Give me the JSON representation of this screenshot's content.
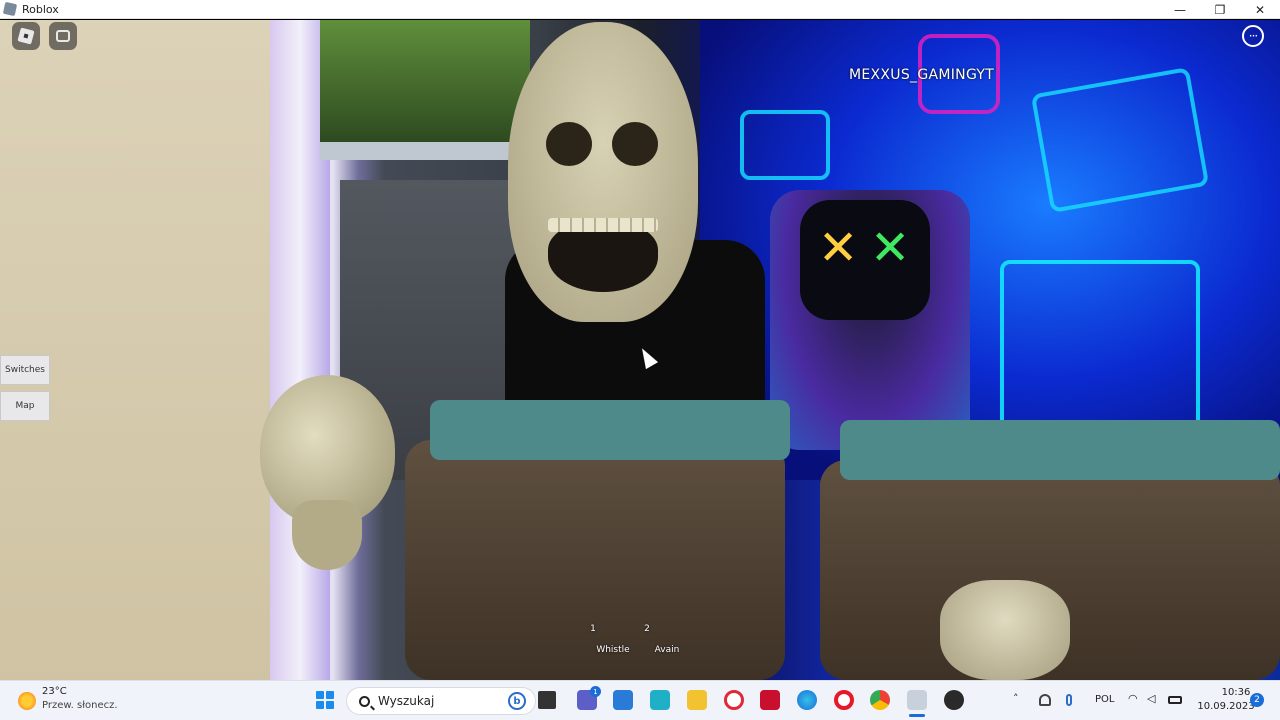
{
  "window": {
    "title": "Roblox",
    "controls": {
      "minimize": "—",
      "maximize": "❐",
      "close": "✕"
    }
  },
  "hud": {
    "menu_icon": "roblox-logo-icon",
    "chat_icon": "chat-icon",
    "more_label": "···",
    "player_name": "MEXXUS_GAMINGYT",
    "side_buttons": [
      {
        "label": "Switches"
      },
      {
        "label": "Map"
      }
    ],
    "hotbar": [
      {
        "slot": "1",
        "label": "Whistle"
      },
      {
        "slot": "2",
        "label": "Avain"
      }
    ]
  },
  "taskbar": {
    "weather": {
      "temp": "23°C",
      "desc": "Przew. słonecz."
    },
    "search_placeholder": "Wyszukaj",
    "chat_badge": "1",
    "apps": [
      "file-explorer-icon",
      "teams-chat-icon",
      "store-icon",
      "l-app-icon",
      "folder-icon",
      "opera-gx-icon",
      "mcafee-icon",
      "edge-icon",
      "opera-icon",
      "chrome-icon",
      "roblox-taskbar-icon",
      "obs-icon"
    ],
    "language": "POL",
    "time": "10:36",
    "date": "10.09.2023",
    "notifications": "2"
  },
  "colors": {
    "accent": "#1a6cd8",
    "taskbar_bg": "#f0f3f9",
    "neon_blue": "#0b2ad0",
    "neon_cyan": "#18d8ff"
  }
}
